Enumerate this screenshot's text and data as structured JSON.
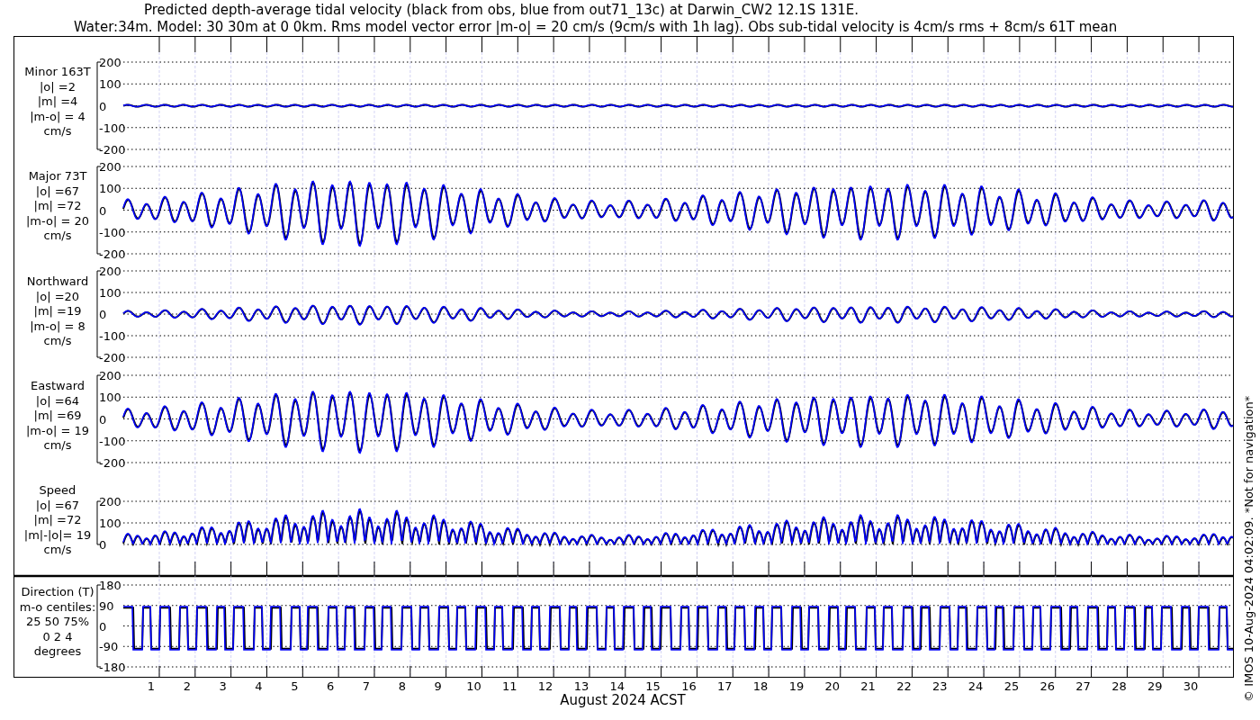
{
  "title": [
    "Predicted depth-average tidal velocity (black from obs, blue from out71_13c) at Darwin_CW2 12.1S 131E.",
    "Water:34m. Model: 30 30m at 0 0km. Rms model vector error |m-o| = 20 cm/s (9cm/s with 1h lag). Obs sub-tidal velocity is 4cm/s rms + 8cm/s 61T mean"
  ],
  "panels": [
    {
      "kind": "minor",
      "label_lines": [
        "Minor 163T",
        "|o| =2",
        "|m| =4",
        "|m-o| = 4",
        "cm/s"
      ],
      "yticks": [
        "200",
        "100",
        "0",
        "-100",
        "-200"
      ]
    },
    {
      "kind": "major",
      "label_lines": [
        "Major 73T",
        "|o| =67",
        "|m| =72",
        "|m-o| = 20",
        "cm/s"
      ],
      "yticks": [
        "200",
        "100",
        "0",
        "-100",
        "-200"
      ]
    },
    {
      "kind": "north",
      "label_lines": [
        "Northward",
        "|o| =20",
        "|m| =19",
        "|m-o| = 8",
        "cm/s"
      ],
      "yticks": [
        "200",
        "100",
        "0",
        "-100",
        "-200"
      ]
    },
    {
      "kind": "east",
      "label_lines": [
        "Eastward",
        "|o| =64",
        "|m| =69",
        "|m-o| = 19",
        "cm/s"
      ],
      "yticks": [
        "200",
        "100",
        "0",
        "-100",
        "-200"
      ]
    },
    {
      "kind": "speed",
      "label_lines": [
        "Speed",
        "|o| =67",
        "|m| =72",
        "|m|-|o|= 19",
        "cm/s"
      ],
      "yticks": [
        "200",
        "100",
        "0"
      ]
    },
    {
      "kind": "direction",
      "label_lines": [
        "Direction (T)",
        "m-o centiles:",
        "25  50  75%",
        "0  2  4",
        "degrees"
      ],
      "yticks": [
        "180",
        "90",
        "0",
        "-90",
        "-180"
      ]
    }
  ],
  "xaxis": {
    "ticks": [
      "1",
      "2",
      "3",
      "4",
      "5",
      "6",
      "7",
      "8",
      "9",
      "10",
      "11",
      "12",
      "13",
      "14",
      "15",
      "16",
      "17",
      "18",
      "19",
      "20",
      "21",
      "22",
      "23",
      "24",
      "25",
      "26",
      "27",
      "28",
      "29",
      "30"
    ],
    "label": "August 2024 ACST"
  },
  "credit": "© IMOS 10-Aug-2024 04:02:09. *Not for navigation*"
}
